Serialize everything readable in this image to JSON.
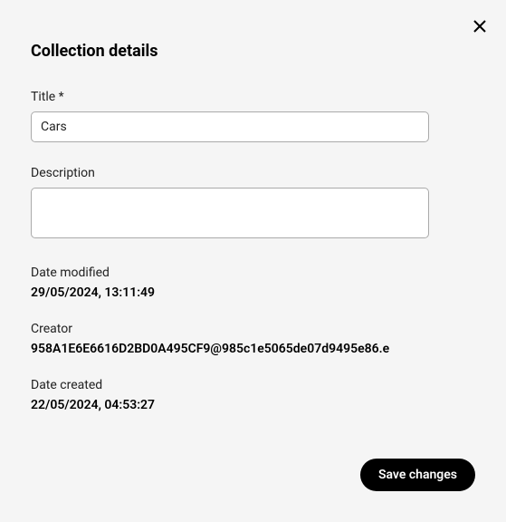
{
  "dialog": {
    "heading": "Collection details",
    "fields": {
      "title": {
        "label": "Title *",
        "value": "Cars"
      },
      "description": {
        "label": "Description",
        "value": ""
      },
      "dateModified": {
        "label": "Date modified",
        "value": "29/05/2024, 13:11:49"
      },
      "creator": {
        "label": "Creator",
        "value": "958A1E6E6616D2BD0A495CF9@985c1e5065de07d9495e86.e"
      },
      "dateCreated": {
        "label": "Date created",
        "value": "22/05/2024, 04:53:27"
      }
    },
    "actions": {
      "save": "Save changes"
    }
  }
}
